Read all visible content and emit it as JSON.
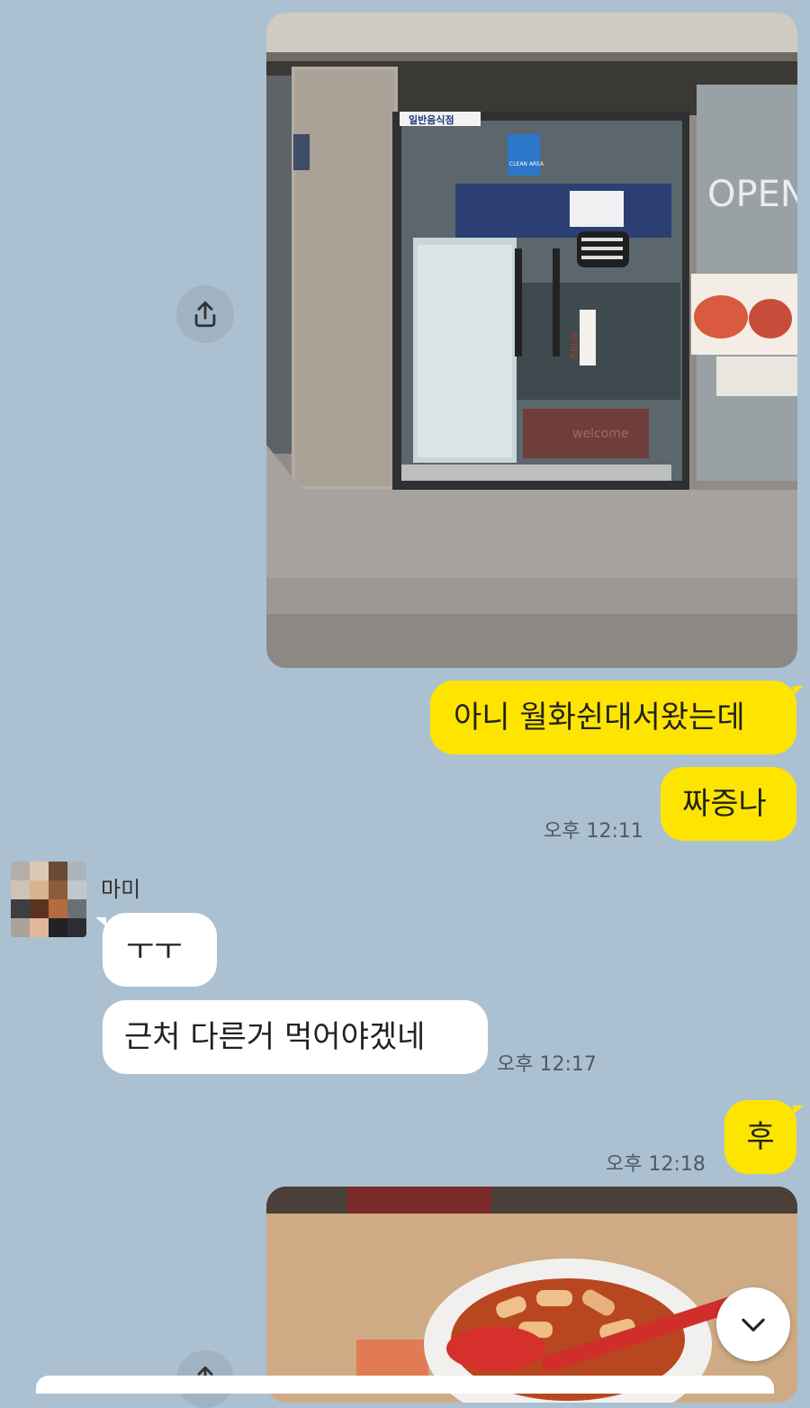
{
  "chat": {
    "messages": [
      {
        "text": "아니 월화쉰대서왔는데"
      },
      {
        "text": "짜증나"
      },
      {
        "text": "ㅜㅜ"
      },
      {
        "text": "근처 다른거 먹어야겠네"
      },
      {
        "text": "후"
      }
    ],
    "timestamps": [
      "오후 12:11",
      "오후 12:17",
      "오후 12:18"
    ],
    "sender_name": "마미"
  },
  "photo1_signs": {
    "category": "일반음식점",
    "clean": "CLEAN AREA",
    "open": "OPEN",
    "holiday": "정기휴일",
    "mat": "welcome"
  },
  "icons": {
    "share": "share-icon",
    "scroll": "chevron-down-icon"
  },
  "colors": {
    "background": "#abc1d1",
    "my_bubble": "#fee500",
    "their_bubble": "#ffffff"
  }
}
